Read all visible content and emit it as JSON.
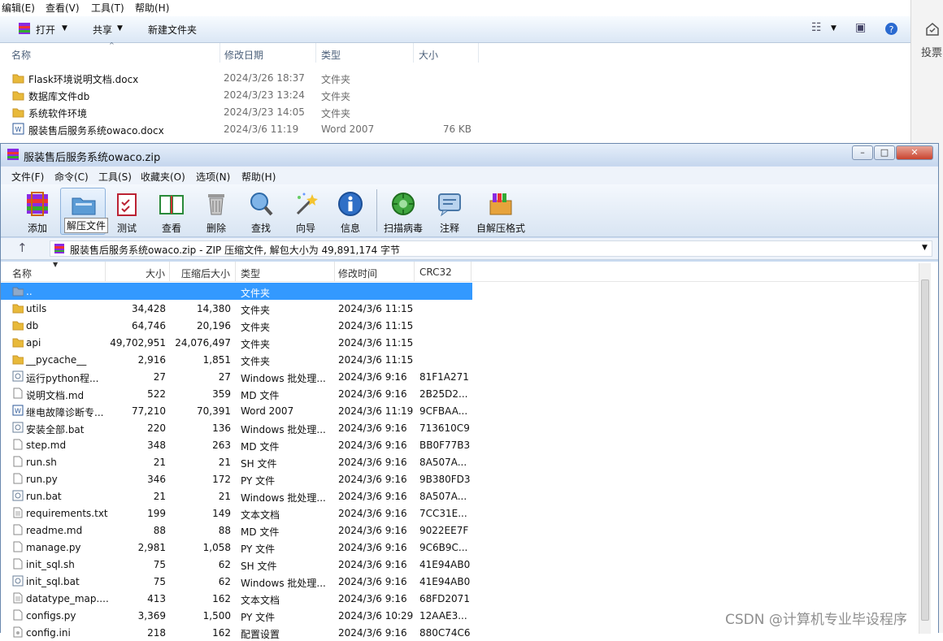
{
  "explorer": {
    "menu": [
      "编辑(E)",
      "查看(V)",
      "工具(T)",
      "帮助(H)"
    ],
    "toolbar": {
      "open": "打开",
      "share": "共享",
      "new_folder": "新建文件夹"
    },
    "columns": {
      "name": "名称",
      "date": "修改日期",
      "type": "类型",
      "size": "大小"
    },
    "rows": [
      {
        "name": "Flask环境说明文档.docx",
        "date": "2024/3/26 18:37",
        "type": "文件夹",
        "size": ""
      },
      {
        "name": "数据库文件db",
        "date": "2024/3/23 13:24",
        "type": "文件夹",
        "size": ""
      },
      {
        "name": "系统软件环境",
        "date": "2024/3/23 14:05",
        "type": "文件夹",
        "size": ""
      },
      {
        "name": "服装售后服务系统owaco.docx",
        "date": "2024/3/6 11:19",
        "type": "Word 2007",
        "size": "76 KB"
      }
    ]
  },
  "side_panel": {
    "label": "投票"
  },
  "rar": {
    "title": "服装售后服务系统owaco.zip",
    "menu": [
      "文件(F)",
      "命令(C)",
      "工具(S)",
      "收藏夹(O)",
      "选项(N)",
      "帮助(H)"
    ],
    "toolbar": {
      "add": "添加",
      "extract": "解压文件",
      "test": "测试",
      "view": "查看",
      "delete": "删除",
      "find": "查找",
      "wizard": "向导",
      "info": "信息",
      "scan": "扫描病毒",
      "comment": "注释",
      "sfx": "自解压格式"
    },
    "path": "服装售后服务系统owaco.zip - ZIP 压缩文件, 解包大小为 49,891,174 字节",
    "columns": {
      "name": "名称",
      "size": "大小",
      "packed": "压缩后大小",
      "type": "类型",
      "modified": "修改时间",
      "crc": "CRC32"
    },
    "rows": [
      {
        "name": "..",
        "size": "",
        "packed": "",
        "type": "文件夹",
        "modified": "",
        "crc": ""
      },
      {
        "name": "utils",
        "size": "34,428",
        "packed": "14,380",
        "type": "文件夹",
        "modified": "2024/3/6 11:15",
        "crc": ""
      },
      {
        "name": "db",
        "size": "64,746",
        "packed": "20,196",
        "type": "文件夹",
        "modified": "2024/3/6 11:15",
        "crc": ""
      },
      {
        "name": "api",
        "size": "49,702,951",
        "packed": "24,076,497",
        "type": "文件夹",
        "modified": "2024/3/6 11:15",
        "crc": ""
      },
      {
        "name": "__pycache__",
        "size": "2,916",
        "packed": "1,851",
        "type": "文件夹",
        "modified": "2024/3/6 11:15",
        "crc": ""
      },
      {
        "name": "运行python程...",
        "size": "27",
        "packed": "27",
        "type": "Windows 批处理...",
        "modified": "2024/3/6 9:16",
        "crc": "81F1A271"
      },
      {
        "name": "说明文档.md",
        "size": "522",
        "packed": "359",
        "type": "MD 文件",
        "modified": "2024/3/6 9:16",
        "crc": "2B25D2..."
      },
      {
        "name": "继电故障诊断专...",
        "size": "77,210",
        "packed": "70,391",
        "type": "Word 2007",
        "modified": "2024/3/6 11:19",
        "crc": "9CFBAA..."
      },
      {
        "name": "安装全部.bat",
        "size": "220",
        "packed": "136",
        "type": "Windows 批处理...",
        "modified": "2024/3/6 9:16",
        "crc": "713610C9"
      },
      {
        "name": "step.md",
        "size": "348",
        "packed": "263",
        "type": "MD 文件",
        "modified": "2024/3/6 9:16",
        "crc": "BB0F77B3"
      },
      {
        "name": "run.sh",
        "size": "21",
        "packed": "21",
        "type": "SH 文件",
        "modified": "2024/3/6 9:16",
        "crc": "8A507A..."
      },
      {
        "name": "run.py",
        "size": "346",
        "packed": "172",
        "type": "PY 文件",
        "modified": "2024/3/6 9:16",
        "crc": "9B380FD3"
      },
      {
        "name": "run.bat",
        "size": "21",
        "packed": "21",
        "type": "Windows 批处理...",
        "modified": "2024/3/6 9:16",
        "crc": "8A507A..."
      },
      {
        "name": "requirements.txt",
        "size": "199",
        "packed": "149",
        "type": "文本文档",
        "modified": "2024/3/6 9:16",
        "crc": "7CC31E..."
      },
      {
        "name": "readme.md",
        "size": "88",
        "packed": "88",
        "type": "MD 文件",
        "modified": "2024/3/6 9:16",
        "crc": "9022EE7F"
      },
      {
        "name": "manage.py",
        "size": "2,981",
        "packed": "1,058",
        "type": "PY 文件",
        "modified": "2024/3/6 9:16",
        "crc": "9C6B9C..."
      },
      {
        "name": "init_sql.sh",
        "size": "75",
        "packed": "62",
        "type": "SH 文件",
        "modified": "2024/3/6 9:16",
        "crc": "41E94AB0"
      },
      {
        "name": "init_sql.bat",
        "size": "75",
        "packed": "62",
        "type": "Windows 批处理...",
        "modified": "2024/3/6 9:16",
        "crc": "41E94AB0"
      },
      {
        "name": "datatype_map....",
        "size": "413",
        "packed": "162",
        "type": "文本文档",
        "modified": "2024/3/6 9:16",
        "crc": "68FD2071"
      },
      {
        "name": "configs.py",
        "size": "3,369",
        "packed": "1,500",
        "type": "PY 文件",
        "modified": "2024/3/6 10:29",
        "crc": "12AAE3..."
      },
      {
        "name": "config.ini",
        "size": "218",
        "packed": "162",
        "type": "配置设置",
        "modified": "2024/3/6 9:16",
        "crc": "880C74C6"
      }
    ]
  },
  "watermark": "CSDN @计算机专业毕设程序"
}
